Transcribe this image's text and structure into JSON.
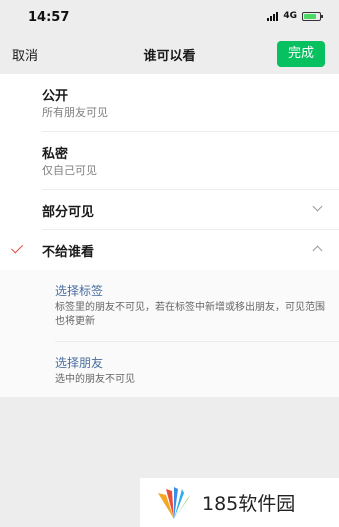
{
  "status_bar": {
    "time": "14:57",
    "network": "4G",
    "battery_level": 0.8
  },
  "nav": {
    "cancel_label": "取消",
    "title": "谁可以看",
    "done_label": "完成"
  },
  "options": {
    "public": {
      "label": "公开",
      "desc": "所有朋友可见"
    },
    "private": {
      "label": "私密",
      "desc": "仅自己可见"
    },
    "partial": {
      "label": "部分可见"
    },
    "exclude": {
      "label": "不给谁看",
      "selected": true
    }
  },
  "exclude_options": {
    "tags": {
      "title": "选择标签",
      "desc": "标签里的朋友不可见，若在标签中新增或移出朋友，可见范围也将更新"
    },
    "friends": {
      "title": "选择朋友",
      "desc": "选中的朋友不可见"
    }
  },
  "watermark": {
    "text": "185软件园"
  },
  "colors": {
    "accent_green": "#07c160",
    "check_red": "#e74c3c",
    "link_blue": "#4a6ea0"
  }
}
